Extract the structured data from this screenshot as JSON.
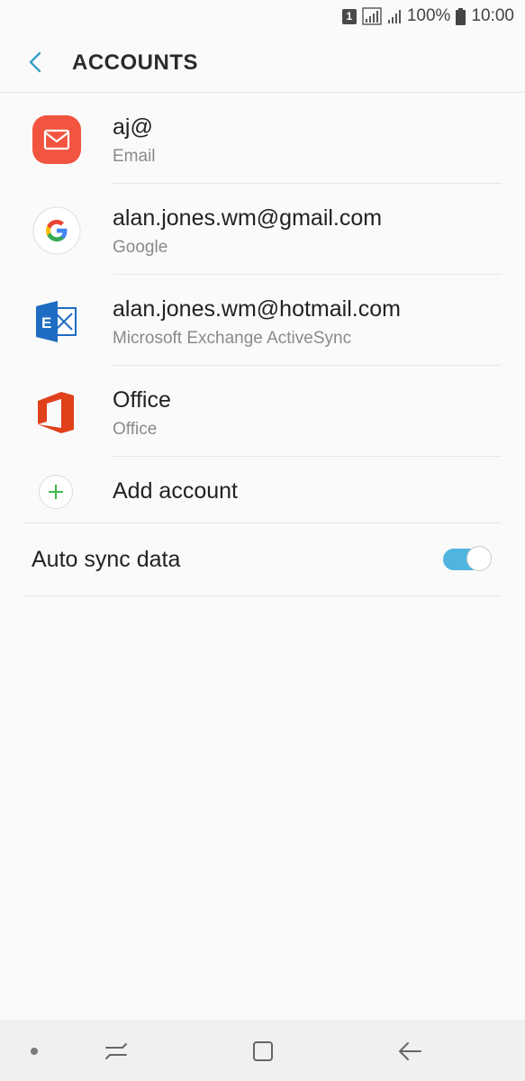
{
  "status_bar": {
    "sim_slot": "1",
    "battery_percent": "100%",
    "time": "10:00"
  },
  "header": {
    "title": "ACCOUNTS",
    "back_icon": "chevron-left-icon"
  },
  "accounts": [
    {
      "primary": "aj@",
      "secondary": "Email",
      "icon": "email-icon",
      "icon_color": "#f2553f"
    },
    {
      "primary": "alan.jones.wm@gmail.com",
      "secondary": "Google",
      "icon": "google-icon"
    },
    {
      "primary": "alan.jones.wm@hotmail.com",
      "secondary": "Microsoft Exchange ActiveSync",
      "icon": "exchange-icon",
      "icon_color": "#1f6cc4"
    },
    {
      "primary": "Office",
      "secondary": "Office",
      "icon": "office-icon",
      "icon_color": "#e0401a"
    }
  ],
  "add_account": {
    "label": "Add account",
    "icon": "plus-icon",
    "icon_color": "#3fb54a"
  },
  "auto_sync": {
    "label": "Auto sync data",
    "enabled": true,
    "accent": "#4fb5e0"
  },
  "nav_bar": {
    "buttons": [
      "dot-indicator",
      "recents-icon",
      "home-icon",
      "back-arrow-icon"
    ]
  }
}
